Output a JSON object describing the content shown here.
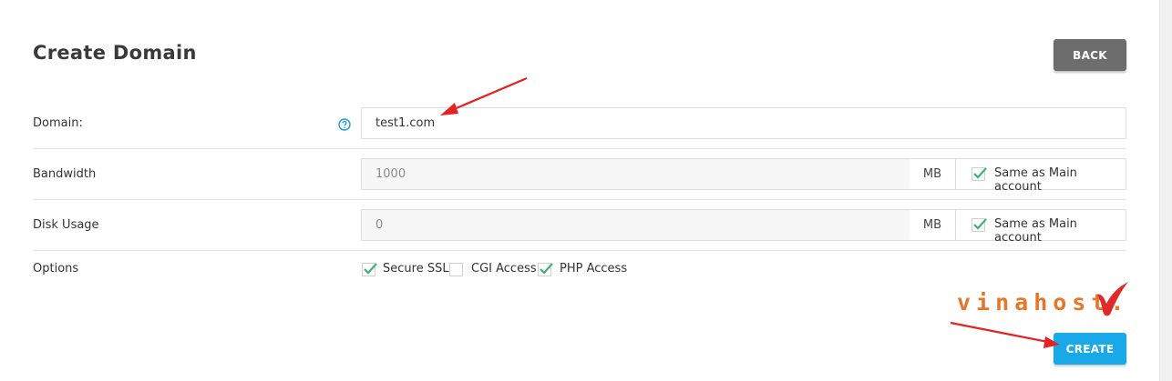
{
  "page": {
    "title": "Create Domain"
  },
  "buttons": {
    "back": "BACK",
    "create": "CREATE"
  },
  "form": {
    "domain": {
      "label": "Domain:",
      "value": "test1.com"
    },
    "bandwidth": {
      "label": "Bandwidth",
      "value": "1000",
      "unit": "MB",
      "same_label": "Same as Main account",
      "same_checked": true
    },
    "disk": {
      "label": "Disk Usage",
      "value": "0",
      "unit": "MB",
      "same_label": "Same as Main account",
      "same_checked": true
    },
    "options": {
      "label": "Options",
      "items": [
        {
          "label": "Secure SSL",
          "checked": true
        },
        {
          "label": "CGI Access",
          "checked": false
        },
        {
          "label": "PHP Access",
          "checked": true
        }
      ]
    }
  },
  "watermark": {
    "text": "vinahost."
  },
  "colors": {
    "create": "#1aa9e8",
    "back": "#6d6d6d",
    "check": "#3cb371",
    "arrow": "#e32222",
    "help": "#1a9bd7",
    "logo": "#e8762a"
  },
  "icons": {
    "help": "question-circle-icon",
    "check": "checkmark-icon"
  }
}
